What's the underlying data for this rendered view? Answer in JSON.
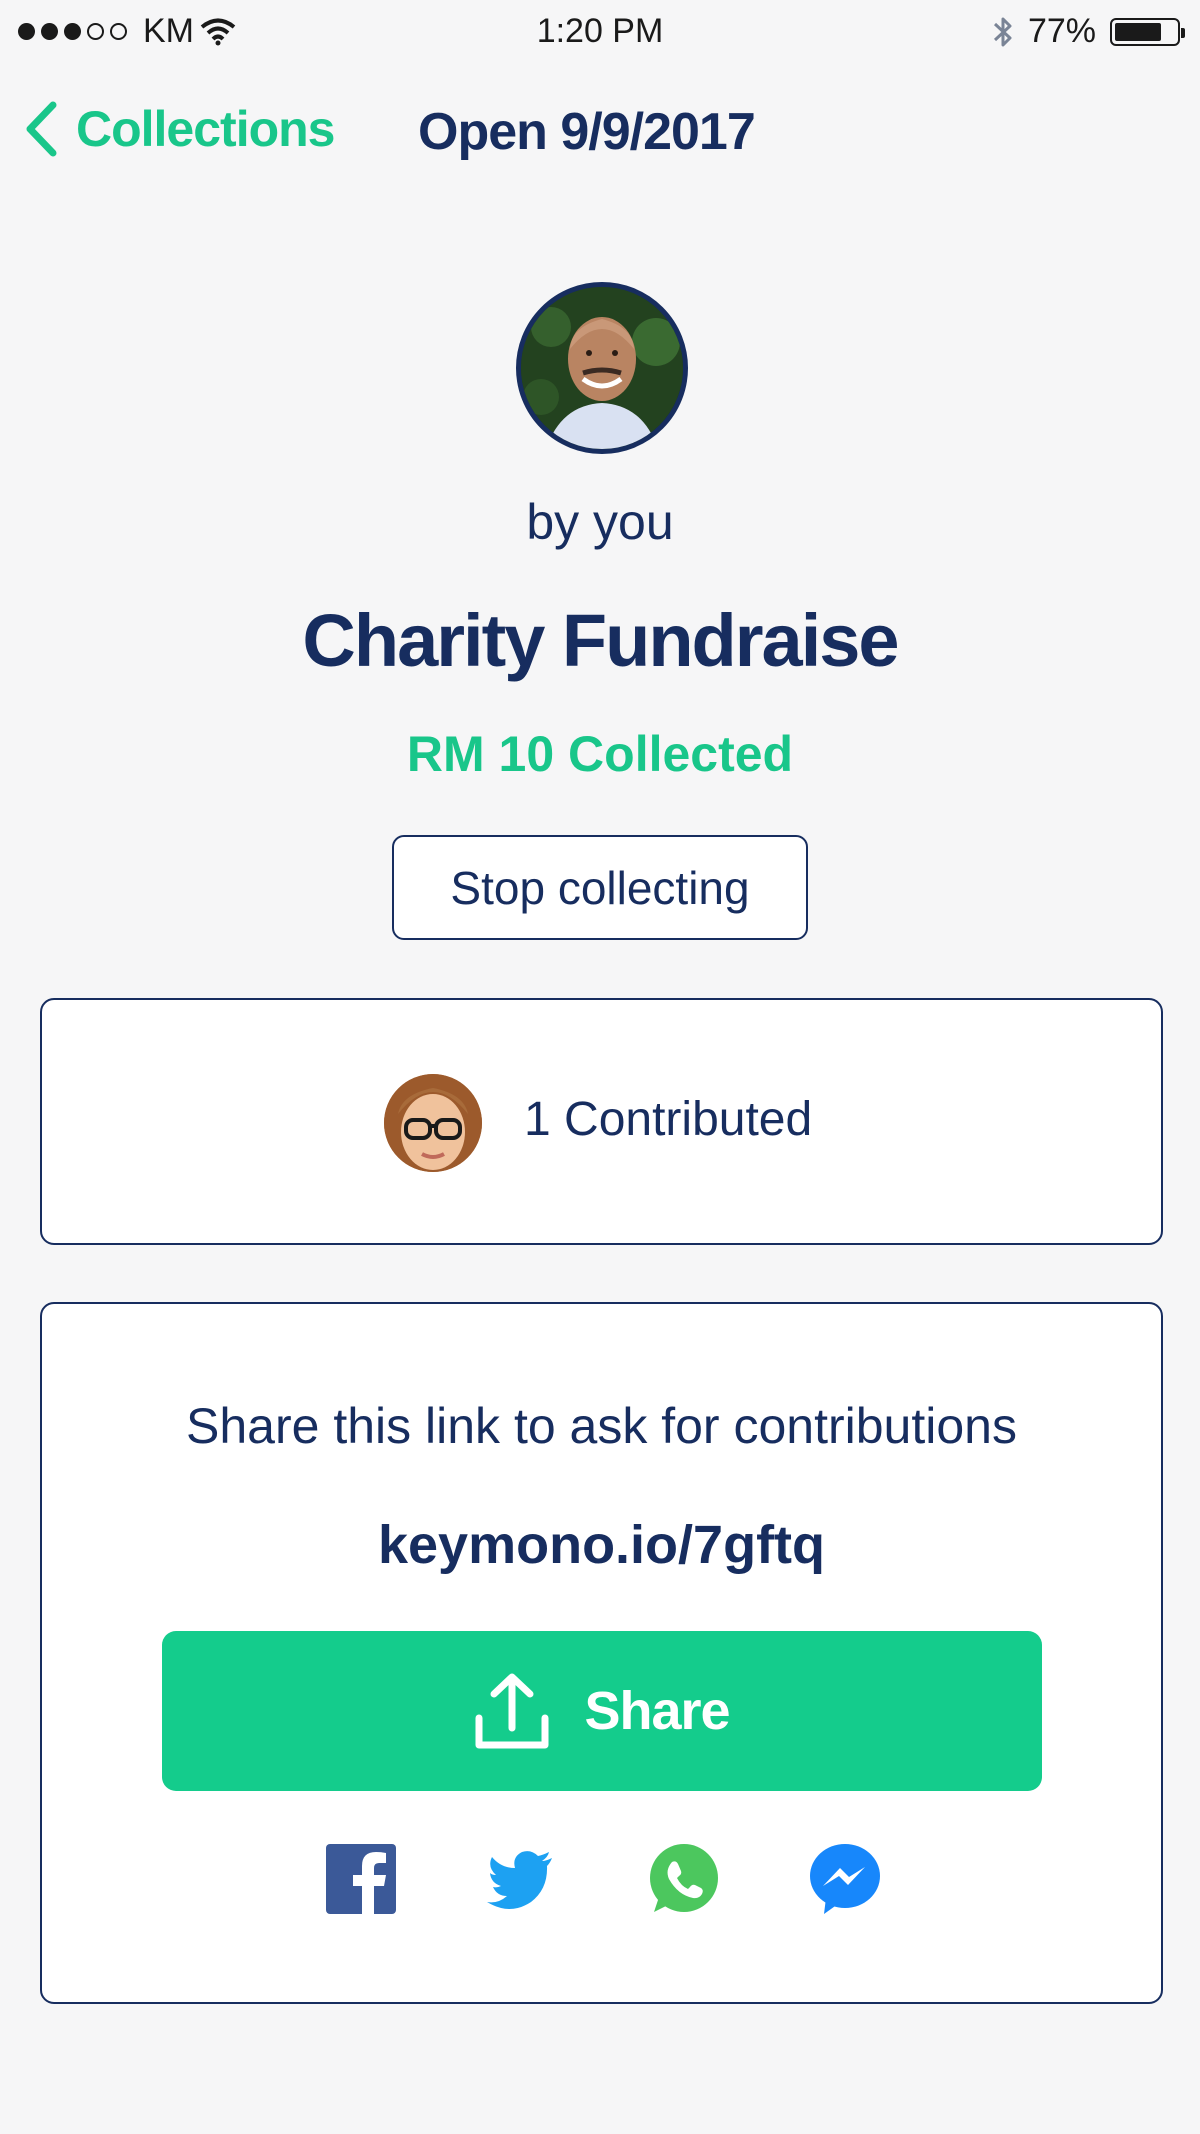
{
  "status_bar": {
    "carrier": "KM",
    "time": "1:20 PM",
    "battery_percent": "77%",
    "battery_level": 0.77
  },
  "nav": {
    "back_label": "Collections",
    "title": "Open 9/9/2017"
  },
  "collection": {
    "owner_label": "by you",
    "title": "Charity Fundraise",
    "collected": "RM 10 Collected",
    "stop_label": "Stop collecting"
  },
  "contributors": {
    "summary": "1 Contributed"
  },
  "share": {
    "prompt": "Share this link to ask for contributions",
    "link": "keymono.io/7gftq",
    "button_label": "Share",
    "icons": [
      "facebook-icon",
      "twitter-icon",
      "whatsapp-icon",
      "messenger-icon"
    ]
  },
  "colors": {
    "navy": "#172d5f",
    "green": "#19c68a",
    "share_green": "#14cc8c",
    "facebook": "#3b5998",
    "twitter": "#1da1f2",
    "whatsapp": "#4cc75e",
    "messenger": "#1787fb"
  }
}
